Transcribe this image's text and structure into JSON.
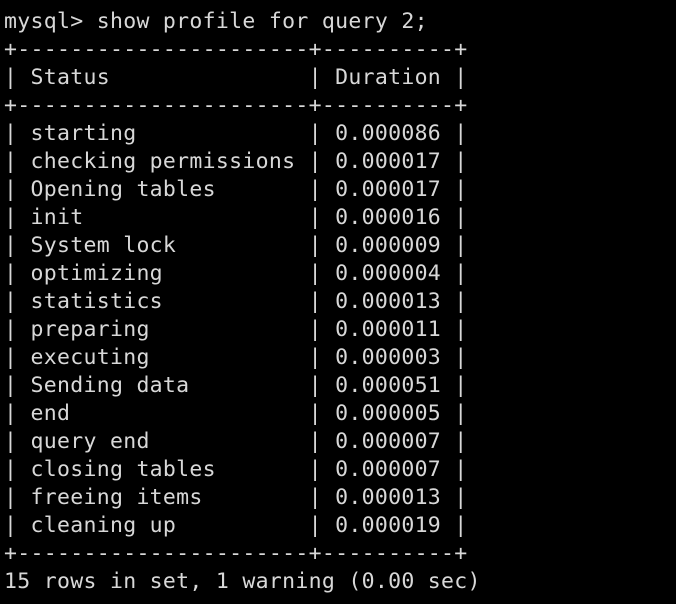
{
  "terminal": {
    "command": "mysql> show profile for query 2;",
    "border": "+----------------------+----------+",
    "header": "| Status               | Duration |",
    "rows": [
      "| starting             | 0.000086 |",
      "| checking permissions | 0.000017 |",
      "| Opening tables       | 0.000017 |",
      "| init                 | 0.000016 |",
      "| System lock          | 0.000009 |",
      "| optimizing           | 0.000004 |",
      "| statistics           | 0.000013 |",
      "| preparing            | 0.000011 |",
      "| executing            | 0.000003 |",
      "| Sending data         | 0.000051 |",
      "| end                  | 0.000005 |",
      "| query end            | 0.000007 |",
      "| closing tables       | 0.000007 |",
      "| freeing items        | 0.000013 |",
      "| cleaning up          | 0.000019 |"
    ],
    "summary": "15 rows in set, 1 warning (0.00 sec)"
  }
}
